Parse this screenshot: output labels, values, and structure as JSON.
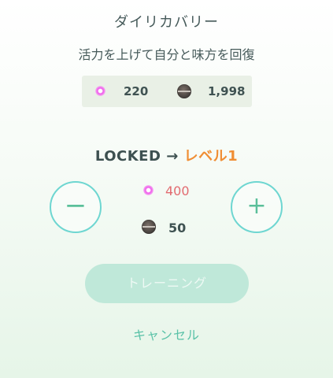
{
  "move": {
    "name": "ダイリカバリー",
    "description": "活力を上げて自分と味方を回復"
  },
  "resources": {
    "stardust_icon": "stardust-icon",
    "stardust_amount": "220",
    "candy_icon": "candy-icon",
    "candy_amount": "1,998"
  },
  "level_change": {
    "from": "LOCKED",
    "arrow": "→",
    "to": "レベル1"
  },
  "cost": {
    "stardust_amount": "400",
    "candy_amount": "50"
  },
  "controls": {
    "decrease_icon": "minus-icon",
    "decrease_glyph": "−",
    "increase_icon": "plus-icon",
    "increase_glyph": "+",
    "train_label": "トレーニング",
    "cancel_label": "キャンセル"
  },
  "colors": {
    "accent_teal": "#6ed6d1",
    "level_orange": "#f08e34",
    "cost_red": "#e26b70",
    "stardust_pink": "#ef57ea"
  }
}
